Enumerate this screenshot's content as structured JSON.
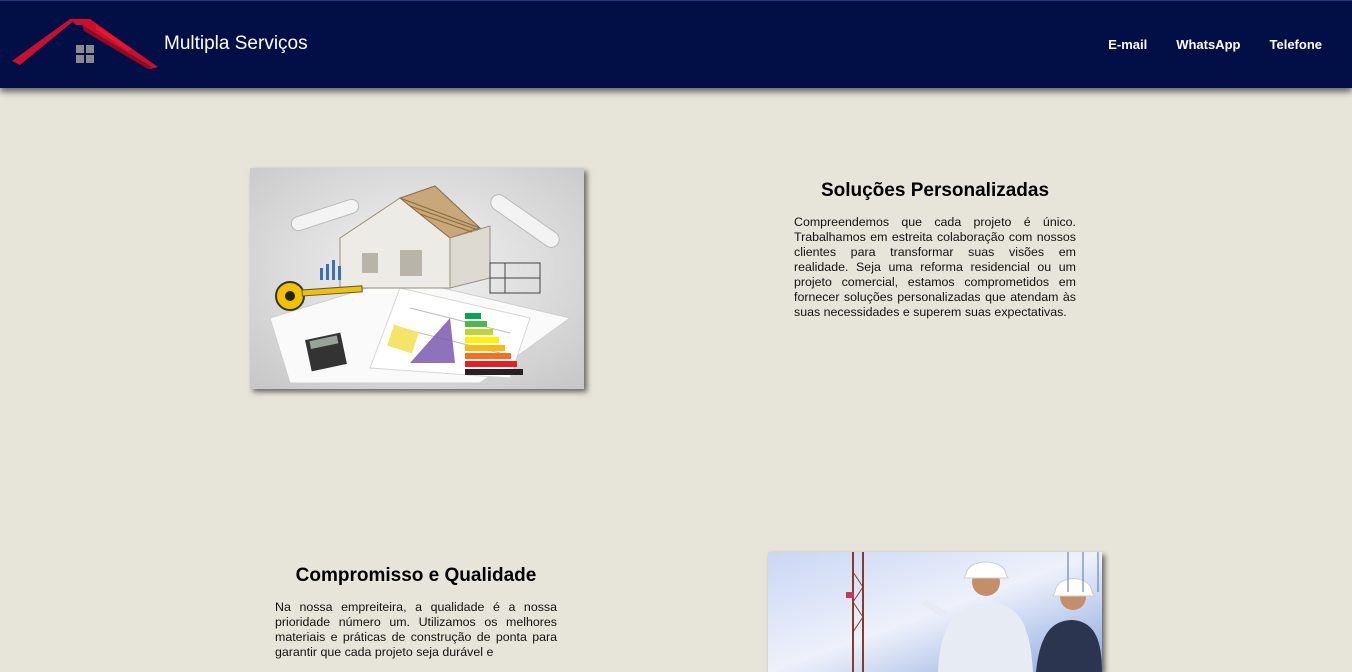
{
  "header": {
    "brand": "Multipla Serviços",
    "nav": [
      "E-mail",
      "WhatsApp",
      "Telefone"
    ]
  },
  "sections": [
    {
      "title": "Soluções Personalizadas",
      "text": "Compreendemos que cada projeto é único. Trabalhamos em estreita colaboração com nossos clientes para transformar suas visões em realidade. Seja uma reforma residencial ou um projeto comercial, estamos comprometidos em fornecer soluções personalizadas que atendam às suas necessidades e superem suas expectativas."
    },
    {
      "title": "Compromisso e Qualidade",
      "text": "Na nossa empreiteira, a qualidade é a nossa prioridade número um. Utilizamos os melhores materiais e práticas de construção de ponta para garantir que cada projeto seja durável e"
    }
  ],
  "colors": {
    "header_bg": "#020f47",
    "page_bg": "#e7e5da",
    "logo_red": "#c8102e"
  }
}
